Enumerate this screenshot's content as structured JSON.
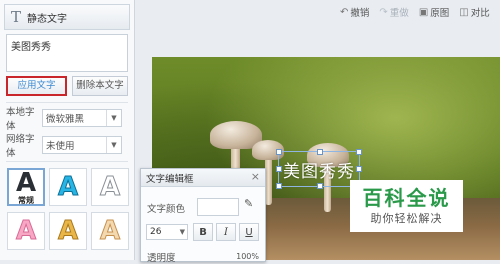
{
  "panel": {
    "title": "静态文字",
    "title_icon": "T",
    "text_value": "美图秀秀",
    "apply_button": "应用文字",
    "delete_button": "删除本文字",
    "local_font_label": "本地字体",
    "local_font_value": "微软雅黑",
    "web_font_label": "网络字体",
    "web_font_value": "未使用",
    "styles": [
      {
        "glyph": "A",
        "sub": "常规"
      },
      {
        "glyph": "A",
        "sub": ""
      },
      {
        "glyph": "A",
        "sub": ""
      },
      {
        "glyph": "A",
        "sub": ""
      },
      {
        "glyph": "A",
        "sub": ""
      },
      {
        "glyph": "A",
        "sub": ""
      }
    ]
  },
  "toolbar": {
    "undo": "撤销",
    "redo": "重做",
    "original": "原图",
    "compare": "对比"
  },
  "canvas": {
    "frame_text": "美图秀秀"
  },
  "dialog": {
    "title": "文字编辑框",
    "close": "×",
    "color_label": "文字颜色",
    "font_size": "26",
    "bold": "B",
    "italic": "I",
    "underline": "U",
    "opacity_label": "透明度",
    "opacity_value": "100%"
  },
  "watermark": {
    "main": "百科全说",
    "sub": "助你轻松解决"
  }
}
